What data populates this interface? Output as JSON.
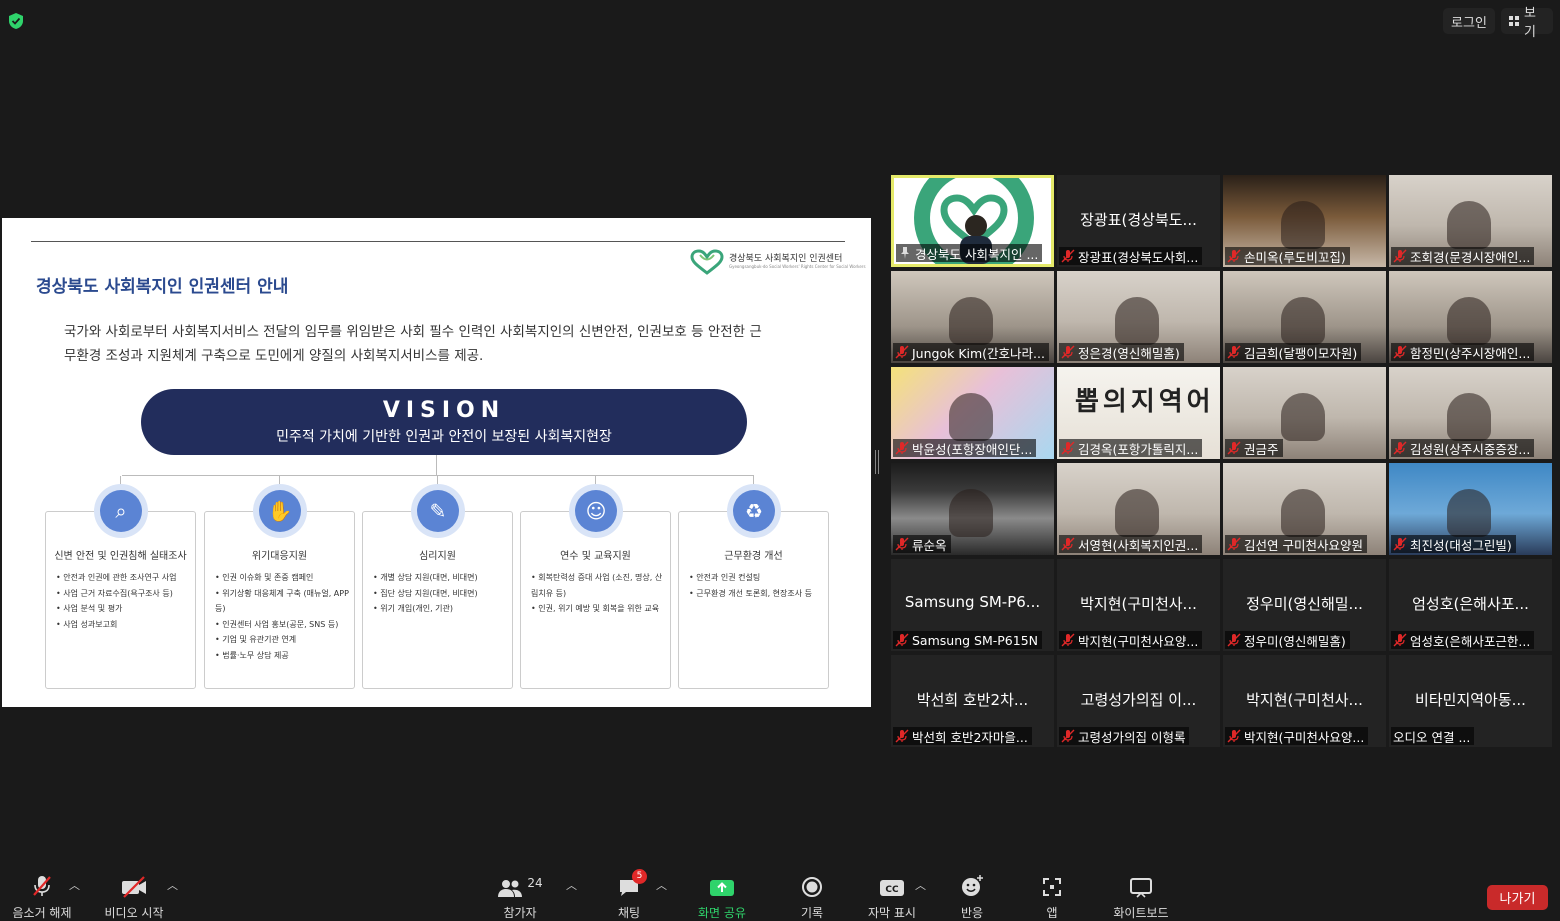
{
  "topbar": {
    "login_label": "로그인",
    "view_label": "보기",
    "security_color": "#2fd36b"
  },
  "slide": {
    "logo_text": "경상북도 사회복지인 인권센터",
    "logo_sub": "Gyeongsangbuk-do Social Workers' Rights Center for Social Workers",
    "title": "경상북도 사회복지인 인권센터 안내",
    "description": "국가와 사회로부터 사회복지서비스 전달의 임무를 위임받은 사회 필수 인력인 사회복지인의 신변안전, 인권보호 등 안전한 근무환경 조성과 지원체계 구축으로 도민에게 양질의 사회복지서비스를 제공.",
    "vision_title": "VISION",
    "vision_subtitle": "민주적 가치에 기반한 인권과 안전이 보장된 사회복지현장",
    "cards": [
      {
        "icon": "magnifier-icon",
        "title": "신변 안전 및 인권침해 실태조사",
        "items": [
          "안전과 인권에 관한 조사연구 사업",
          "사업 근거 자료수집(욕구조사 등)",
          "사업 분석 및 평가",
          "사업 성과보고회"
        ]
      },
      {
        "icon": "hands-icon",
        "title": "위기대응지원",
        "items": [
          "인권 이슈화 및 존중 캠페인",
          "위기상황 대응체계 구축 (매뉴얼, APP 등)",
          "인권센터 사업 홍보(공문, SNS 등)",
          "기업 및 유관기관 연계",
          "법률·노무 상담 제공"
        ]
      },
      {
        "icon": "syringe-icon",
        "title": "심리지원",
        "items": [
          "개별 상담 지원(대면, 비대면)",
          "집단 상담 지원(대면, 비대면)",
          "위기 개입(개인, 기관)"
        ]
      },
      {
        "icon": "training-icon",
        "title": "연수 및 교육지원",
        "items": [
          "회복탄력성 증대 사업 (소진, 명상, 산림치유 등)",
          "인권, 위기 예방 및 회복을 위한 교육"
        ]
      },
      {
        "icon": "recycle-icon",
        "title": "근무환경 개선",
        "items": [
          "안전과 인권 컨설팅",
          "근무환경 개선 토론회, 현장조사 등"
        ]
      }
    ]
  },
  "participants": [
    {
      "label": "경상북도 사회복지인 ...",
      "big": "",
      "muted": false,
      "pinned": true,
      "active": true,
      "video": "logo"
    },
    {
      "label": "장광표(경상북도사회...",
      "big": "장광표(경상북도...",
      "muted": true,
      "video": "none"
    },
    {
      "label": "손미옥(루도비꼬집)",
      "big": "",
      "muted": true,
      "video": "cam-dark"
    },
    {
      "label": "조회경(문경시장애인...",
      "big": "",
      "muted": true,
      "video": "cam-light"
    },
    {
      "label": "Jungok Kim(간호나라...",
      "big": "",
      "muted": true,
      "video": "cam-room"
    },
    {
      "label": "정은경(영신해밀홈)",
      "big": "",
      "muted": true,
      "video": "cam-light"
    },
    {
      "label": "김금희(달팽이모자원)",
      "big": "",
      "muted": true,
      "video": "cam-room"
    },
    {
      "label": "함정민(상주시장애인...",
      "big": "",
      "muted": true,
      "video": "cam-room"
    },
    {
      "label": "박윤성(포항장애인단...",
      "big": "",
      "muted": true,
      "video": "cam-color"
    },
    {
      "label": "김경옥(포항가톨릭지...",
      "big": "",
      "muted": true,
      "video": "cam-text"
    },
    {
      "label": "권금주",
      "big": "",
      "muted": true,
      "video": "cam-light"
    },
    {
      "label": "김성원(상주시중증장...",
      "big": "",
      "muted": true,
      "video": "cam-light"
    },
    {
      "label": "류순옥",
      "big": "",
      "muted": true,
      "video": "cam-dim"
    },
    {
      "label": "서영현(사회복지인권...",
      "big": "",
      "muted": true,
      "video": "cam-light"
    },
    {
      "label": "김선연 구미천사요양원",
      "big": "",
      "muted": true,
      "video": "cam-light"
    },
    {
      "label": "최진성(대성그린빌)",
      "big": "",
      "muted": true,
      "video": "cam-blue"
    },
    {
      "label": "Samsung SM-P615N",
      "big": "Samsung  SM-P6...",
      "muted": true,
      "video": "none"
    },
    {
      "label": "박지현(구미천사요양...",
      "big": "박지현(구미천사...",
      "muted": true,
      "video": "none"
    },
    {
      "label": "정우미(영신해밀홈)",
      "big": "정우미(영신해밀...",
      "muted": true,
      "video": "none"
    },
    {
      "label": "엄성호(은해사포근한...",
      "big": "엄성호(은해사포...",
      "muted": true,
      "video": "none"
    },
    {
      "label": "박선희 호반2자마을...",
      "big": "박선희 호반2차...",
      "muted": true,
      "video": "none"
    },
    {
      "label": "고령성가의집 이형록",
      "big": "고령성가의집 이...",
      "muted": true,
      "video": "none"
    },
    {
      "label": "박지현(구미천사요양...",
      "big": "박지현(구미천사...",
      "muted": true,
      "video": "none"
    },
    {
      "label": "오디오 연결 ...",
      "big": "비타민지역아동...",
      "muted": false,
      "video": "none"
    }
  ],
  "toolbar": {
    "unmute_label": "음소거 해제",
    "video_label": "비디오 시작",
    "participants_label": "참가자",
    "participants_count": "24",
    "chat_label": "채팅",
    "chat_badge": "5",
    "share_label": "화면 공유",
    "record_label": "기록",
    "captions_label": "자막 표시",
    "reactions_label": "반응",
    "apps_label": "앱",
    "whiteboard_label": "화이트보드",
    "leave_label": "나가기",
    "share_color": "#2fd36b",
    "leave_color": "#c92a2a"
  }
}
